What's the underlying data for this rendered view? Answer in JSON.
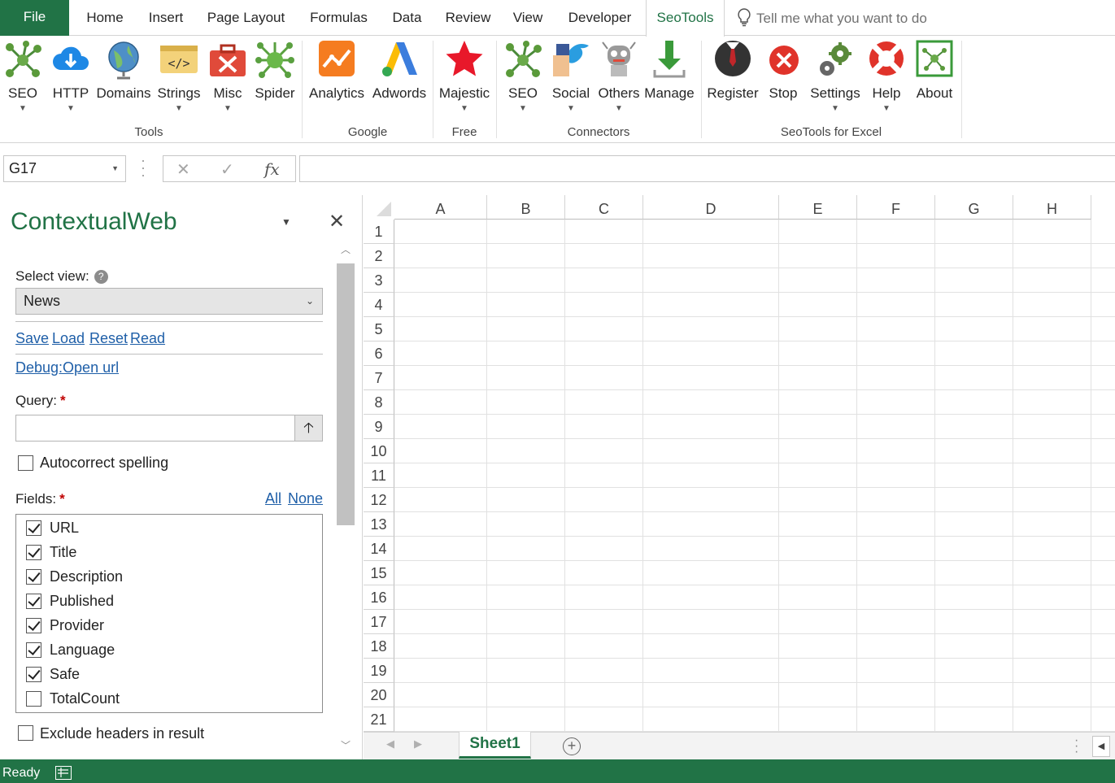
{
  "tabs": [
    "File",
    "Home",
    "Insert",
    "Page Layout",
    "Formulas",
    "Data",
    "Review",
    "View",
    "Developer",
    "SeoTools"
  ],
  "active_tab": "SeoTools",
  "tell_me": "Tell me what you want to do",
  "ribbon": {
    "buttons": [
      {
        "label": "SEO",
        "icon": "network-icon",
        "dropdown": true
      },
      {
        "label": "HTTP",
        "icon": "cloud-download-icon",
        "dropdown": true
      },
      {
        "label": "Domains",
        "icon": "globe-icon",
        "dropdown": false
      },
      {
        "label": "Strings",
        "icon": "code-icon",
        "dropdown": true
      },
      {
        "label": "Misc",
        "icon": "toolbox-icon",
        "dropdown": true
      },
      {
        "label": "Spider",
        "icon": "spider-icon",
        "dropdown": false
      },
      {
        "label": "Analytics",
        "icon": "analytics-icon",
        "dropdown": false
      },
      {
        "label": "Adwords",
        "icon": "adwords-icon",
        "dropdown": false
      },
      {
        "label": "Majestic",
        "icon": "star-icon",
        "dropdown": true
      },
      {
        "label": "SEO",
        "icon": "network-icon",
        "dropdown": true
      },
      {
        "label": "Social",
        "icon": "social-icon",
        "dropdown": true
      },
      {
        "label": "Others",
        "icon": "robot-icon",
        "dropdown": true
      },
      {
        "label": "Manage",
        "icon": "download-arrow-icon",
        "dropdown": false
      },
      {
        "label": "Register",
        "icon": "register-icon",
        "dropdown": false
      },
      {
        "label": "Stop",
        "icon": "stop-icon",
        "dropdown": false
      },
      {
        "label": "Settings",
        "icon": "gears-icon",
        "dropdown": true
      },
      {
        "label": "Help",
        "icon": "lifebuoy-icon",
        "dropdown": true
      },
      {
        "label": "About",
        "icon": "about-icon",
        "dropdown": false
      }
    ],
    "groups": [
      "Tools",
      "Google",
      "Free",
      "Connectors",
      "SeoTools for Excel"
    ]
  },
  "name_box": "G17",
  "pane": {
    "title": "ContextualWeb",
    "select_view_label": "Select view:",
    "select_view_value": "News",
    "links": [
      "Save",
      "Load",
      "Reset",
      "Read"
    ],
    "debug_link": "Debug:Open url",
    "query_label": "Query:",
    "query_value": "",
    "autocorrect_label": "Autocorrect spelling",
    "autocorrect_checked": false,
    "fields_label": "Fields:",
    "fields_all": "All",
    "fields_none": "None",
    "fields": [
      {
        "name": "URL",
        "checked": true
      },
      {
        "name": "Title",
        "checked": true
      },
      {
        "name": "Description",
        "checked": true
      },
      {
        "name": "Published",
        "checked": true
      },
      {
        "name": "Provider",
        "checked": true
      },
      {
        "name": "Language",
        "checked": true
      },
      {
        "name": "Safe",
        "checked": true
      },
      {
        "name": "TotalCount",
        "checked": false
      }
    ],
    "exclude_headers_label": "Exclude headers in result",
    "exclude_headers_checked": false
  },
  "grid": {
    "columns": [
      "A",
      "B",
      "C",
      "D",
      "E",
      "F",
      "G",
      "H"
    ],
    "rows": [
      "1",
      "2",
      "3",
      "4",
      "5",
      "6",
      "7",
      "8",
      "9",
      "10",
      "11",
      "12",
      "13",
      "14",
      "15",
      "16",
      "17",
      "18",
      "19",
      "20",
      "21"
    ]
  },
  "sheet_tab": "Sheet1",
  "status": "Ready",
  "colors": {
    "accent": "#217346",
    "link": "#1f5fa8"
  }
}
